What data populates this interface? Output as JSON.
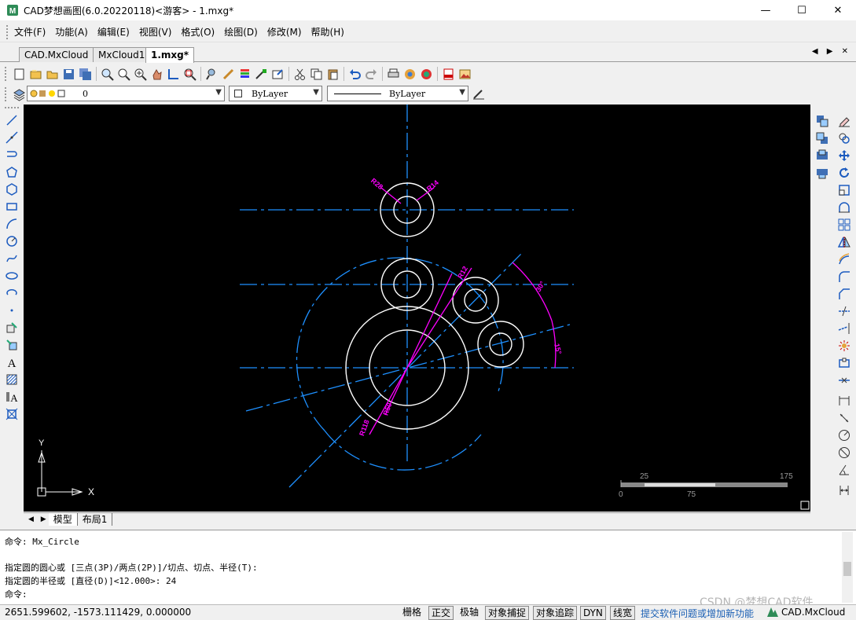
{
  "window": {
    "title": "CAD梦想画图(6.0.20220118)<游客> - 1.mxg*",
    "controls": [
      "—",
      "☐",
      "✕"
    ]
  },
  "menu": [
    "文件(F)",
    "功能(A)",
    "编辑(E)",
    "视图(V)",
    "格式(O)",
    "绘图(D)",
    "修改(M)",
    "帮助(H)"
  ],
  "tabs": [
    {
      "label": "CAD.MxCloud",
      "active": false
    },
    {
      "label": "MxCloud1",
      "active": false
    },
    {
      "label": "1.mxg*",
      "active": true
    }
  ],
  "tab_nav": "◀ ▶ ✕",
  "layer_bar": {
    "layer_value": "0",
    "color_value": "ByLayer",
    "linetype_value": "ByLayer"
  },
  "layout_tabs": [
    "模型",
    "布局1"
  ],
  "drawing": {
    "dims": {
      "r1": "R28",
      "r2": "R14",
      "r3": "R12",
      "r4": "R50",
      "r5": "R118",
      "a1": "30°",
      "a2": "15°"
    },
    "ucs_x": "X",
    "ucs_y": "Y",
    "scale_top": [
      "25",
      "175"
    ],
    "scale_bottom": [
      "0",
      "75"
    ]
  },
  "command": {
    "lines": [
      "命令: Mx_Circle",
      "",
      "指定圆的圆心或 [三点(3P)/两点(2P)]/切点、切点、半径(T):",
      "指定圆的半径或 [直径(D)]<12.000>: 24",
      "命令:"
    ]
  },
  "status": {
    "coords": "2651.599602, -1573.111429, 0.000000",
    "toggles": [
      {
        "label": "栅格",
        "on": false
      },
      {
        "label": "正交",
        "on": true
      },
      {
        "label": "极轴",
        "on": false
      },
      {
        "label": "对象捕捉",
        "on": true
      },
      {
        "label": "对象追踪",
        "on": true
      },
      {
        "label": "DYN",
        "on": true
      },
      {
        "label": "线宽",
        "on": true
      }
    ],
    "link": "提交软件问题或增加新功能",
    "brand": "CAD.MxCloud"
  },
  "watermark": "CSDN @梦想CAD软件",
  "colors": {
    "canvas_bg": "#000000",
    "center_line": "#1e90ff",
    "circle": "#ffffff",
    "dimension": "#ff00ff",
    "link": "#1a5fb4"
  }
}
